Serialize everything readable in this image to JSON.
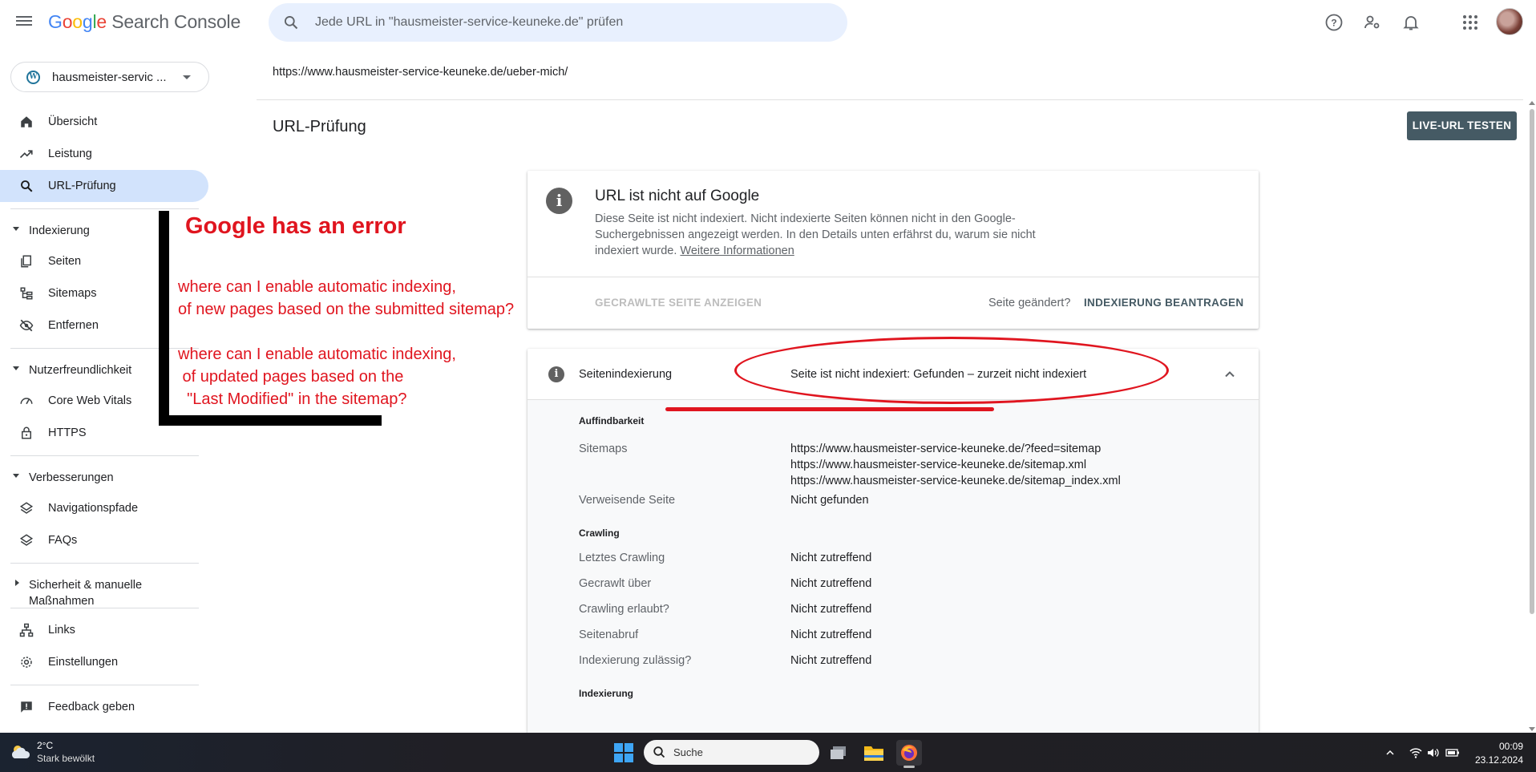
{
  "app": {
    "title_google": "Google",
    "title_rest": " Search Console",
    "search_placeholder": "Jede URL in \"hausmeister-service-keuneke.de\" prüfen",
    "property": "hausmeister-servic ..."
  },
  "sidebar": {
    "top_items": [
      {
        "label": "Übersicht",
        "icon": "home-icon"
      },
      {
        "label": "Leistung",
        "icon": "trending-up-icon"
      },
      {
        "label": "URL-Prüfung",
        "icon": "search-icon",
        "active": true
      }
    ],
    "sections": [
      {
        "label": "Indexierung",
        "items": [
          "Seiten",
          "Sitemaps",
          "Entfernen"
        ]
      },
      {
        "label": "Nutzerfreundlichkeit",
        "items": [
          "Core Web Vitals",
          "HTTPS"
        ]
      },
      {
        "label": "Verbesserungen",
        "items": [
          "Navigationspfade",
          "FAQs"
        ]
      },
      {
        "label": "Sicherheit & manuelle Maßnahmen",
        "items": []
      }
    ],
    "bottom_items": [
      "Links",
      "Einstellungen",
      "Feedback geben"
    ]
  },
  "main": {
    "url": "https://www.hausmeister-service-keuneke.de/ueber-mich/",
    "page_title": "URL-Prüfung",
    "live_button": "LIVE-URL TESTEN",
    "status_card": {
      "title": "URL ist nicht auf Google",
      "description": "Diese Seite ist nicht indexiert. Nicht indexierte Seiten können nicht in den Google-Suchergebnissen angezeigt werden. In den Details unten erfährst du, warum sie nicht indexiert wurde.",
      "link": "Weitere Informationen",
      "crawled_button": "GECRAWLTE SEITE ANZEIGEN",
      "changed_text": "Seite geändert?",
      "request_button": "INDEXIERUNG BEANTRAGEN"
    },
    "indexing_card": {
      "label": "Seitenindexierung",
      "value": "Seite ist nicht indexiert: Gefunden – zurzeit nicht indexiert",
      "discovery_heading": "Auffindbarkeit",
      "sitemaps_label": "Sitemaps",
      "sitemaps": [
        "https://www.hausmeister-service-keuneke.de/?feed=sitemap",
        "https://www.hausmeister-service-keuneke.de/sitemap.xml",
        "https://www.hausmeister-service-keuneke.de/sitemap_index.xml"
      ],
      "referring_label": "Verweisende Seite",
      "referring_value": "Nicht gefunden",
      "crawling_heading": "Crawling",
      "crawling_rows": [
        {
          "label": "Letztes Crawling",
          "value": "Nicht zutreffend"
        },
        {
          "label": "Gecrawlt über",
          "value": "Nicht zutreffend"
        },
        {
          "label": "Crawling erlaubt?",
          "value": "Nicht zutreffend"
        },
        {
          "label": "Seitenabruf",
          "value": "Nicht zutreffend"
        },
        {
          "label": "Indexierung zulässig?",
          "value": "Nicht zutreffend"
        }
      ],
      "indexing_heading": "Indexierung"
    }
  },
  "annotation": {
    "title": "Google has an error",
    "lines": [
      "where can I enable automatic indexing,",
      "of new pages based on the submitted sitemap?",
      "where can I enable automatic indexing,",
      " of updated pages based on the",
      "  \"Last Modified\" in the sitemap?"
    ],
    "color": "#e0151f"
  },
  "taskbar": {
    "weather_temp": "2°C",
    "weather_desc": "Stark bewölkt",
    "search_label": "Suche",
    "time": "00:09",
    "date": "23.12.2024"
  },
  "colors": {
    "accent_active": "#d2e3fc",
    "search_bg": "#e8f0fe",
    "live_button_bg": "#455a64"
  }
}
